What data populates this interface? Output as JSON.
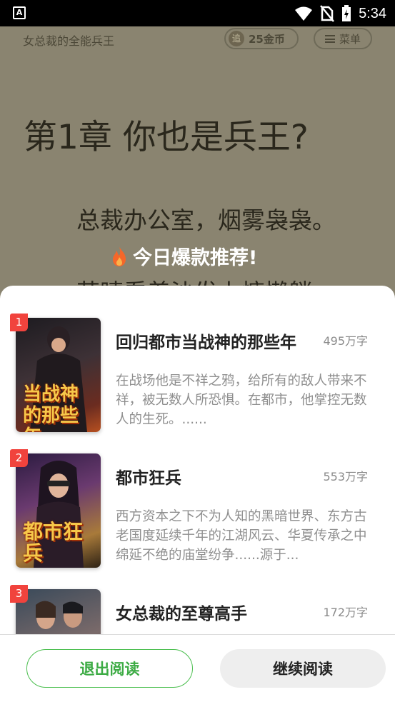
{
  "status_bar": {
    "time": "5:34"
  },
  "reader": {
    "book_title": "女总裁的全能兵王",
    "coins": "25金币",
    "menu_label": "菜单",
    "chapter_title": "第1章 你也是兵王?",
    "paragraph_1": "总裁办公室，烟雾袅袅。",
    "paragraph_2": "苏晴看着沙发上慵懒躺"
  },
  "recommend": {
    "title": "今日爆款推荐!",
    "books": [
      {
        "rank": "1",
        "title": "回归都市当战神的那些年",
        "words": "495万字",
        "description": "在战场他是不祥之鸦，给所有的敌人带来不祥，被无数人所恐惧。在都市，他掌控无数人的生死。......",
        "cover_text": "当战神的那些年"
      },
      {
        "rank": "2",
        "title": "都市狂兵",
        "words": "553万字",
        "description": "西方资本之下不为人知的黑暗世界、东方古老国度延续千年的江湖风云、华夏传承之中绵延不绝的庙堂纷争......源于...",
        "cover_text": "都市狂兵"
      },
      {
        "rank": "3",
        "title": "女总裁的至尊高手",
        "words": "172万字",
        "description": "",
        "cover_text": ""
      }
    ]
  },
  "footer": {
    "exit_label": "退出阅读",
    "continue_label": "继续阅读"
  }
}
